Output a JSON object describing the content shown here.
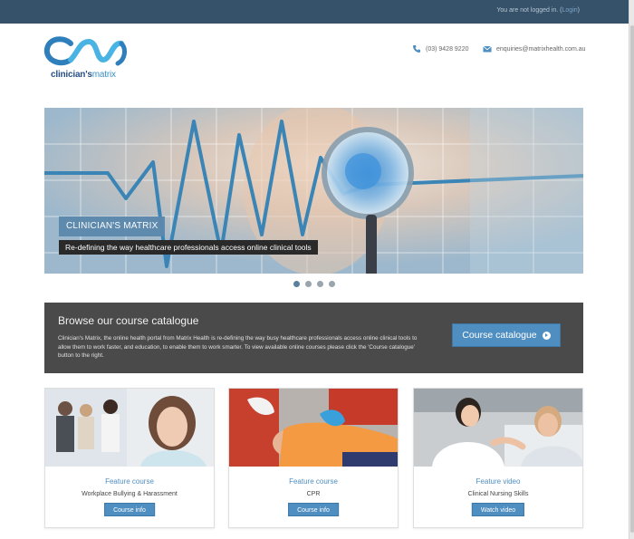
{
  "topbar": {
    "login_text": "You are not logged in. (",
    "login_link": "Login",
    "login_close": ")"
  },
  "brand": {
    "logo_text_a": "clinician's",
    "logo_text_b": "matrix"
  },
  "contact": {
    "phone": "(03) 9428 9220",
    "email": "enquiries@matrixhealth.com.au"
  },
  "hero": {
    "caption_title": "CLINICIAN'S MATRIX",
    "caption_text": "Re-defining the way healthcare professionals access online clinical tools",
    "slides": 4,
    "active_slide": 1
  },
  "catalogue": {
    "title": "Browse our course catalogue",
    "description": "Clinician's Matrix, the online health portal from Matrix Health is re-defining the way busy healthcare professionals access online clinical tools to allow them to work faster, and education, to enable them to work smarter. To view available online courses please click the 'Course catalogue' button to the right.",
    "button": "Course catalogue"
  },
  "cards": [
    {
      "kind": "Feature course",
      "name": "Workplace Bullying & Harassment",
      "button": "Course info"
    },
    {
      "kind": "Feature course",
      "name": "CPR",
      "button": "Course info"
    },
    {
      "kind": "Feature video",
      "name": "Clinical Nursing Skills",
      "button": "Watch video"
    }
  ],
  "icons": {
    "phone": "phone-icon",
    "email": "envelope-icon",
    "play": "play-circle-icon"
  },
  "colors": {
    "topbar": "#35526a",
    "accent": "#4f8ec0",
    "catalogue_bg": "#4a4a4a",
    "brand_dark": "#2a4f87"
  }
}
